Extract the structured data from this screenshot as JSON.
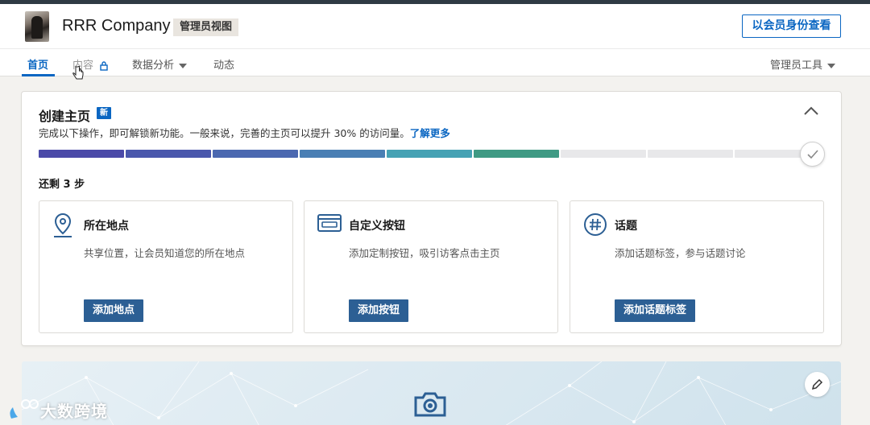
{
  "header": {
    "company_name": "RRR Company",
    "admin_badge": "管理员视图",
    "view_as_member": "以会员身份查看"
  },
  "nav": {
    "home": "首页",
    "content": "内容",
    "analytics": "数据分析",
    "activity": "动态",
    "admin_tools": "管理员工具",
    "active_tab": "首页"
  },
  "setup_card": {
    "title": "创建主页",
    "new_badge": "新",
    "description": "完成以下操作，即可解锁新功能。一般来说，完善的主页可以提升 30% 的访问量。",
    "learn_more": "了解更多",
    "progress_segments_total": 9,
    "progress_segments_done": 6,
    "remaining": "还剩 3 步",
    "steps": [
      {
        "icon": "location-pin-icon",
        "title": "所在地点",
        "desc": "共享位置，让会员知道您的所在地点",
        "button": "添加地点"
      },
      {
        "icon": "custom-button-icon",
        "title": "自定义按钮",
        "desc": "添加定制按钮，吸引访客点击主页",
        "button": "添加按钮"
      },
      {
        "icon": "hashtag-icon",
        "title": "话题",
        "desc": "添加话题标签，参与话题讨论",
        "button": "添加话题标签"
      }
    ]
  },
  "watermark": {
    "text": "大数跨境"
  },
  "colors": {
    "accent": "#0a66c2",
    "button_fill": "#2c5f94",
    "progress": [
      "#4b4aa8",
      "#4a57ac",
      "#4b68b0",
      "#4a7fb4",
      "#46a2b4",
      "#3f9a84"
    ],
    "progress_empty": "#e8e8ea"
  }
}
